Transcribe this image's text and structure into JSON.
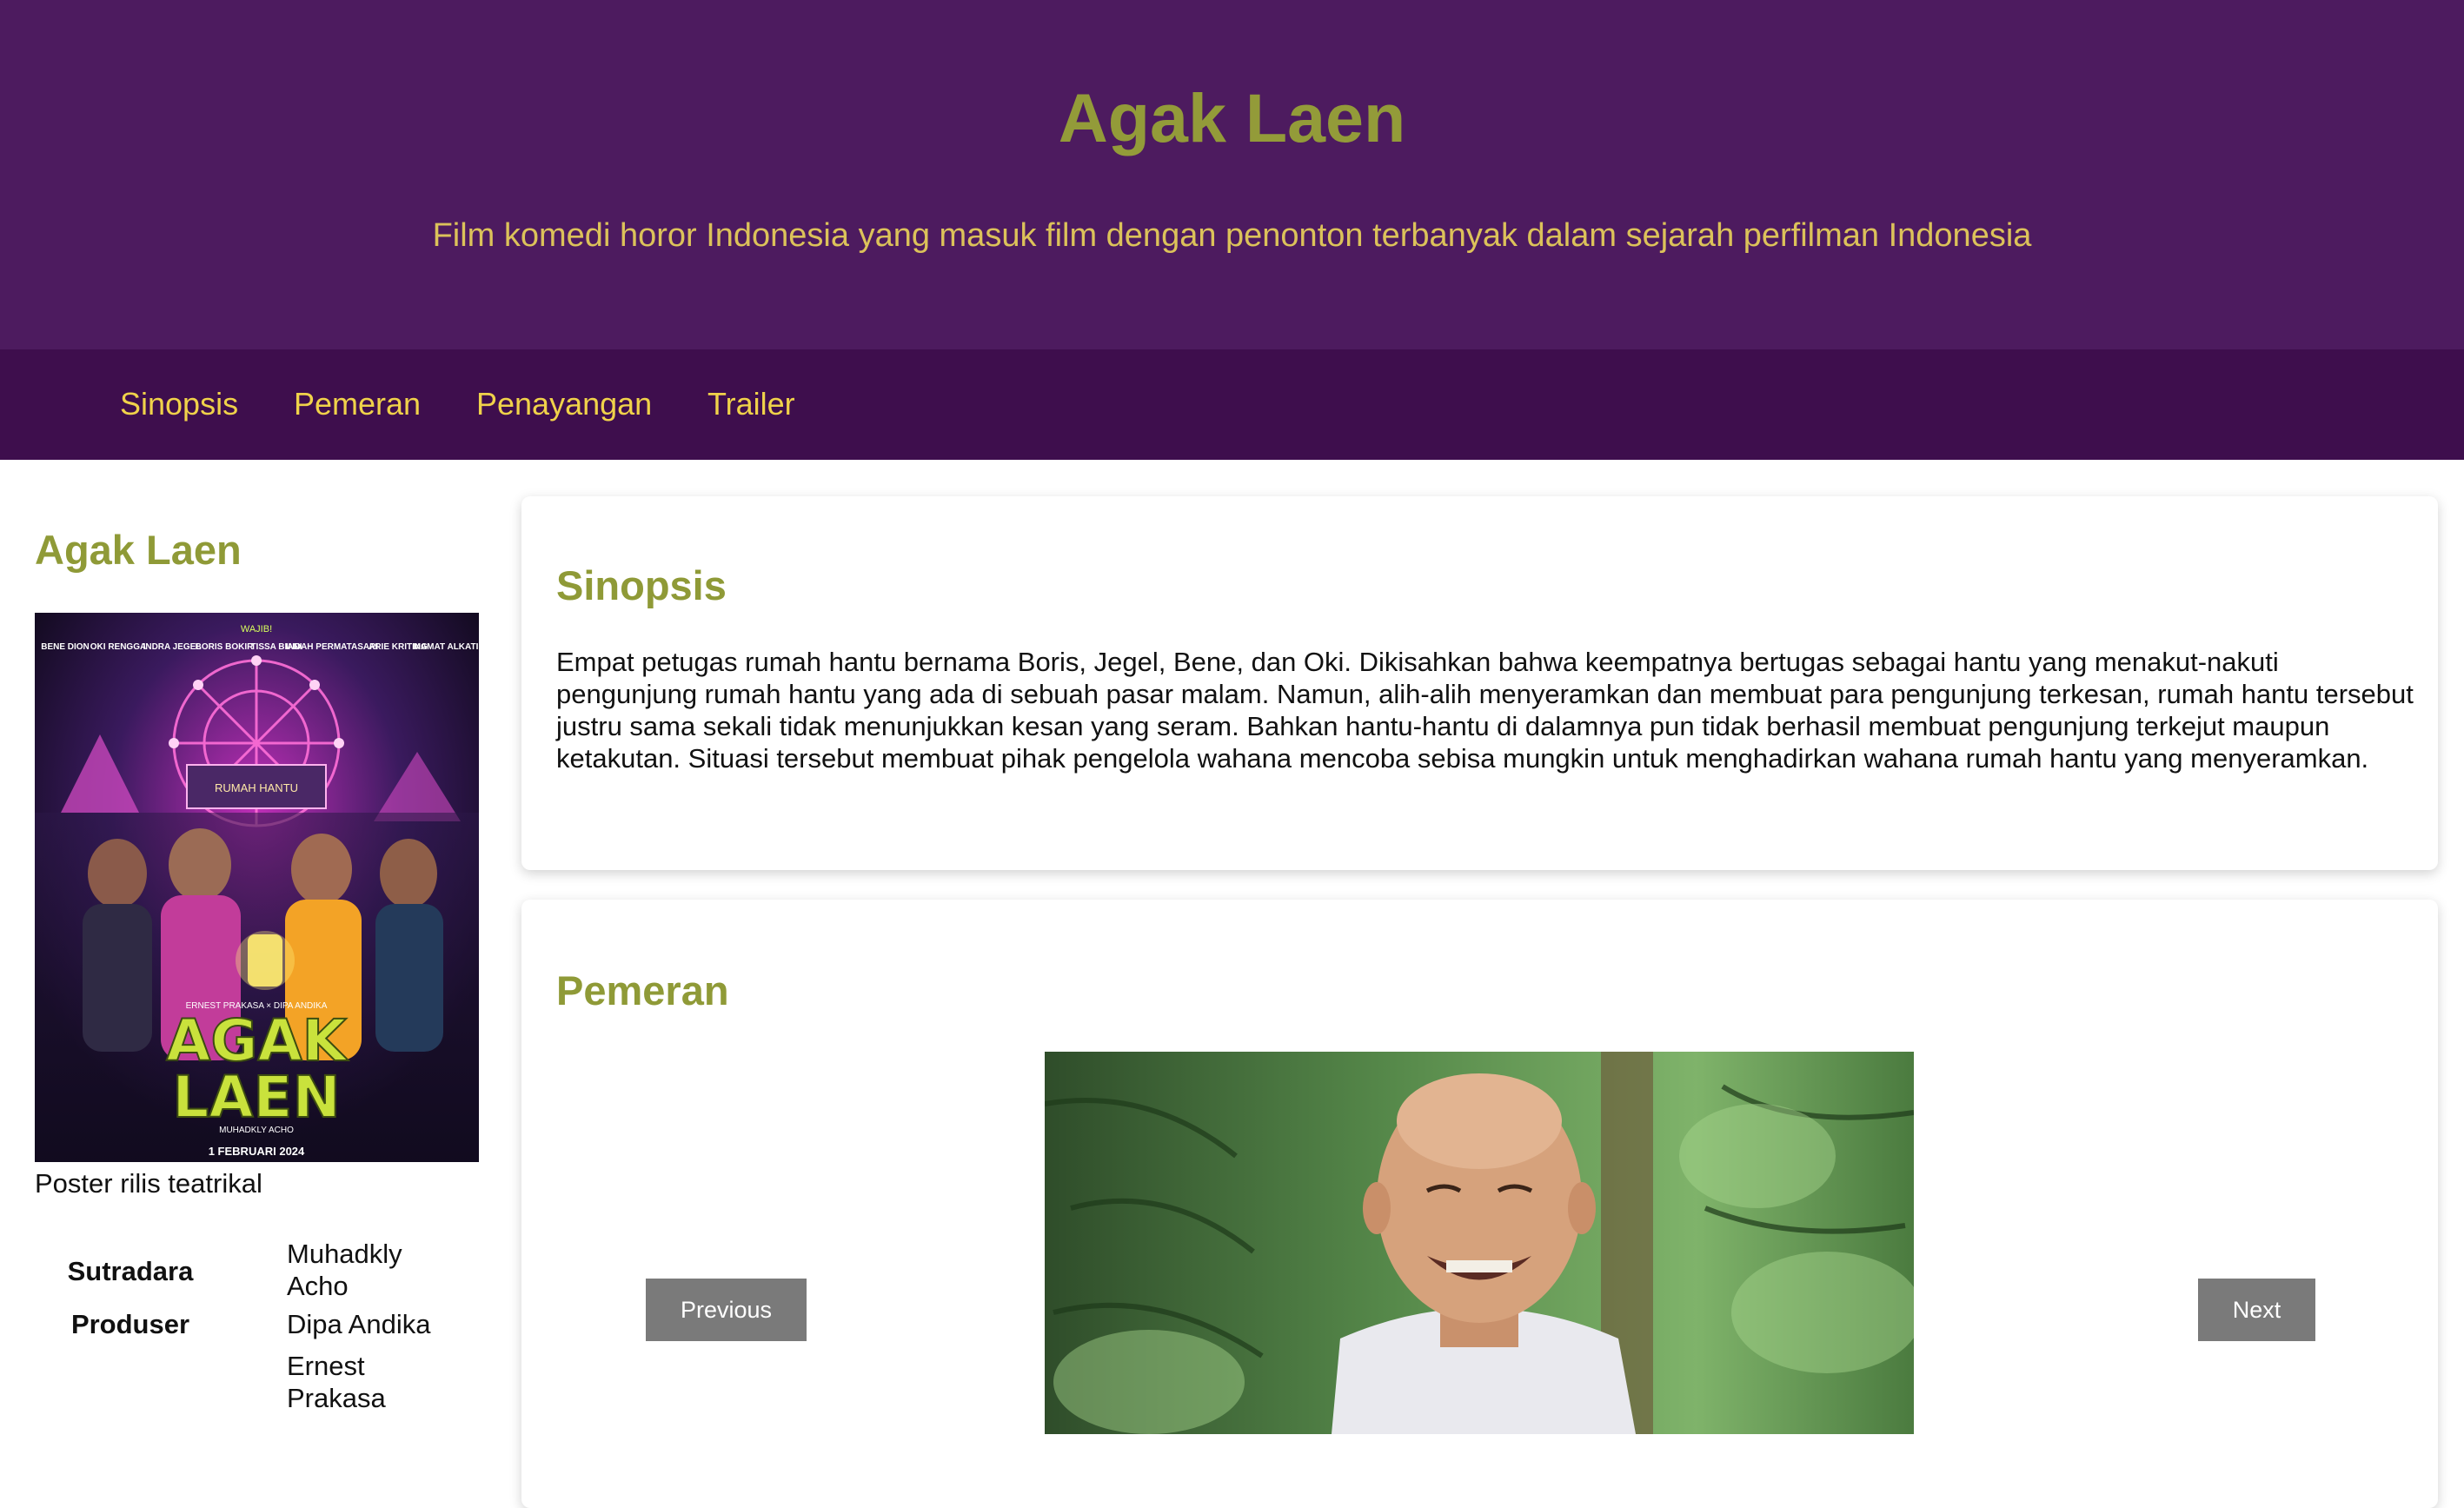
{
  "header": {
    "title": "Agak Laen",
    "subtitle": "Film komedi horor Indonesia yang masuk film dengan penonton terbanyak dalam sejarah perfilman Indonesia"
  },
  "nav": {
    "items": [
      {
        "label": "Sinopsis"
      },
      {
        "label": "Pemeran"
      },
      {
        "label": "Penayangan"
      },
      {
        "label": "Trailer"
      }
    ]
  },
  "sidebar": {
    "title": "Agak Laen",
    "poster": {
      "caption": "Poster rilis teatrikal",
      "title_line1": "AGAK",
      "title_line2": "LAEN",
      "top_text": "WAJIB!",
      "house_label": "RUMAH HANTU",
      "credit_line": "ERNEST PRAKASA × DIPA ANDIKA",
      "director_line": "MUHADKLY ACHO",
      "release": "1 FEBRUARI 2024",
      "cast_names": [
        "BENE DION",
        "OKI RENGGA",
        "INDRA JEGEL",
        "BORIS BOKIR",
        "TISSA BIANI",
        "INDAH PERMATASARI",
        "ARIE KRITING",
        "MAMAT ALKATIRI"
      ]
    },
    "info": [
      {
        "label": "Sutradara",
        "value": "Muhadkly Acho"
      },
      {
        "label": "Produser",
        "value": "Dipa Andika"
      },
      {
        "label": "",
        "value": "Ernest Prakasa"
      }
    ]
  },
  "synopsis": {
    "heading": "Sinopsis",
    "text": "Empat petugas rumah hantu bernama Boris, Jegel, Bene, dan Oki. Dikisahkan bahwa keempatnya bertugas sebagai hantu yang menakut-nakuti pengunjung rumah hantu yang ada di sebuah pasar malam. Namun, alih-alih menyeramkan dan membuat para pengunjung terkesan, rumah hantu tersebut justru sama sekali tidak menunjukkan kesan yang seram. Bahkan hantu-hantu di dalamnya pun tidak berhasil membuat pengunjung terkejut maupun ketakutan. Situasi tersebut membuat pihak pengelola wahana mencoba sebisa mungkin untuk menghadirkan wahana rumah hantu yang menyeramkan."
  },
  "cast": {
    "heading": "Pemeran",
    "prev_label": "Previous",
    "next_label": "Next"
  },
  "colors": {
    "header_bg": "#4d1b5f",
    "nav_bg": "#3e0e4d",
    "title": "#939b39",
    "subtitle": "#dcc25a",
    "nav_link": "#f0d24a",
    "button_bg": "#7a7a7a"
  }
}
